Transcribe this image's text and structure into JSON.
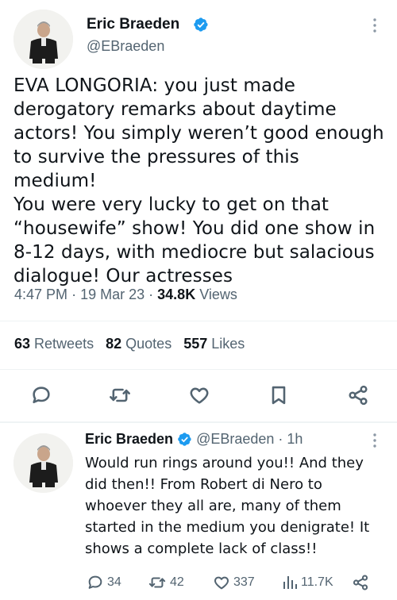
{
  "main_tweet": {
    "author_name": "Eric Braeden",
    "handle": "@EBraeden",
    "lines": [
      "EVA LONGORIA: you just made",
      "derogatory remarks about daytime",
      "actors! You simply weren’t good enough",
      "to survive the pressures of this medium!",
      "You were very lucky to get on that",
      "“housewife” show! You did one show in",
      "8-12 days, with mediocre but  salacious",
      "dialogue! Our actresses"
    ],
    "time": "4:47 PM",
    "date": "19 Mar 23",
    "views_count": "34.8K",
    "views_label": "Views",
    "sep": "·",
    "retweets_count": "63",
    "retweets_label": "Retweets",
    "quotes_count": "82",
    "quotes_label": "Quotes",
    "likes_count": "557",
    "likes_label": "Likes"
  },
  "reply_tweet": {
    "author_name": "Eric Braeden",
    "handle": "@EBraeden",
    "sep": "·",
    "age": "1h",
    "lines": [
      "Would run rings around you!! And they",
      "did then!! From Robert di Nero to",
      "whoever they all are, many of them",
      "started in the medium you denigrate! It",
      "shows a complete lack of class!!"
    ],
    "replies_count": "34",
    "retweets_count": "42",
    "likes_count": "337",
    "views_count": "11.7K"
  },
  "colors": {
    "verified": "#1d9bf0",
    "secondary_text": "#536471",
    "primary_text": "#0f1419",
    "divider": "#eff3f4"
  },
  "icons": [
    "verified-badge-icon",
    "more-icon",
    "reply-icon",
    "retweet-icon",
    "like-icon",
    "bookmark-icon",
    "share-icon",
    "views-icon"
  ]
}
